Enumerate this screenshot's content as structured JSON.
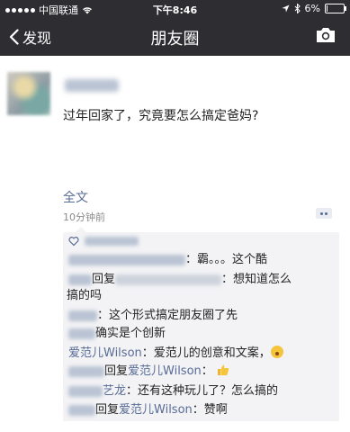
{
  "status_bar": {
    "carrier": "中国联通",
    "time": "下午8:46",
    "battery": "6%",
    "battery_level": 0.06
  },
  "nav": {
    "back_label": "发现",
    "title": "朋友圈"
  },
  "post": {
    "text": "过年回家了，究竟要怎么搞定爸妈?",
    "full_text_label": "全文",
    "time": "10分钟前"
  },
  "comments": [
    {
      "reply_to": "",
      "text": "霸。。。这个酷"
    },
    {
      "reply_label": "回复",
      "reply_to": "",
      "text": "想知道怎么"
    },
    {
      "continuation": "搞的吗"
    },
    {
      "text": "这个形式搞定朋友圈了先"
    },
    {
      "text": "确实是个创新"
    },
    {
      "author": "爱范儿Wilson",
      "text": "爱范儿的创意和文案，"
    },
    {
      "reply_label": "回复",
      "reply_to": "爱范儿Wilson",
      "text": ""
    },
    {
      "author_suffix": "艺龙",
      "text": "还有这种玩儿了？怎么搞的"
    },
    {
      "reply_label": "回复",
      "reply_to": "爱范儿Wilson",
      "text": "赞啊"
    }
  ],
  "icons": {
    "back": "chevron-left-icon",
    "camera": "camera-icon",
    "like": "heart-icon",
    "comment": "comment-dots-icon",
    "wifi": "wifi-icon",
    "bluetooth": "bluetooth-icon",
    "location": "location-arrow-icon"
  },
  "colors": {
    "bar_bg": "#2e2e32",
    "link": "#576b95",
    "comment_bg": "#f3f3f5"
  }
}
